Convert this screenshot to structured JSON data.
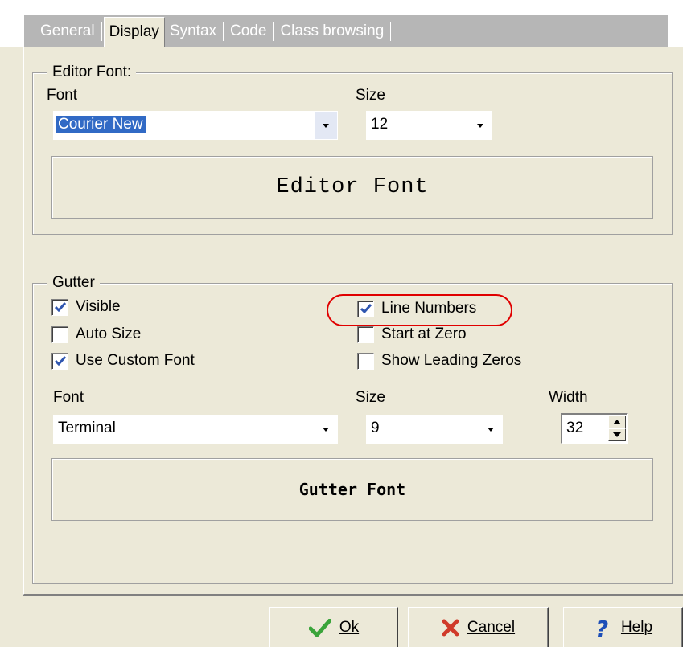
{
  "tabs": [
    {
      "label": "General"
    },
    {
      "label": "Display",
      "active": true
    },
    {
      "label": "Syntax"
    },
    {
      "label": "Code"
    },
    {
      "label": "Class browsing"
    }
  ],
  "editor_font": {
    "group_label": "Editor Font:",
    "font_label": "Font",
    "font_value": "Courier New",
    "size_label": "Size",
    "size_value": "12",
    "preview_text": "Editor Font"
  },
  "gutter": {
    "group_label": "Gutter",
    "options": {
      "visible": {
        "label": "Visible",
        "checked": true
      },
      "auto_size": {
        "label": "Auto Size",
        "checked": false
      },
      "use_custom_font": {
        "label": "Use Custom Font",
        "checked": true
      },
      "line_numbers": {
        "label": "Line Numbers",
        "checked": true
      },
      "start_at_zero": {
        "label": "Start at Zero",
        "checked": false
      },
      "show_leading_zeros": {
        "label": "Show Leading Zeros",
        "checked": false
      }
    },
    "font_label": "Font",
    "font_value": "Terminal",
    "size_label": "Size",
    "size_value": "9",
    "width_label": "Width",
    "width_value": "32",
    "preview_text": "Gutter Font"
  },
  "buttons": {
    "ok": "Ok",
    "cancel": "Cancel",
    "help": "Help"
  },
  "colors": {
    "dialog_bg": "#ece9d8",
    "selection": "#316ac5",
    "annotation": "#e00000",
    "check": "#2f56b0"
  }
}
